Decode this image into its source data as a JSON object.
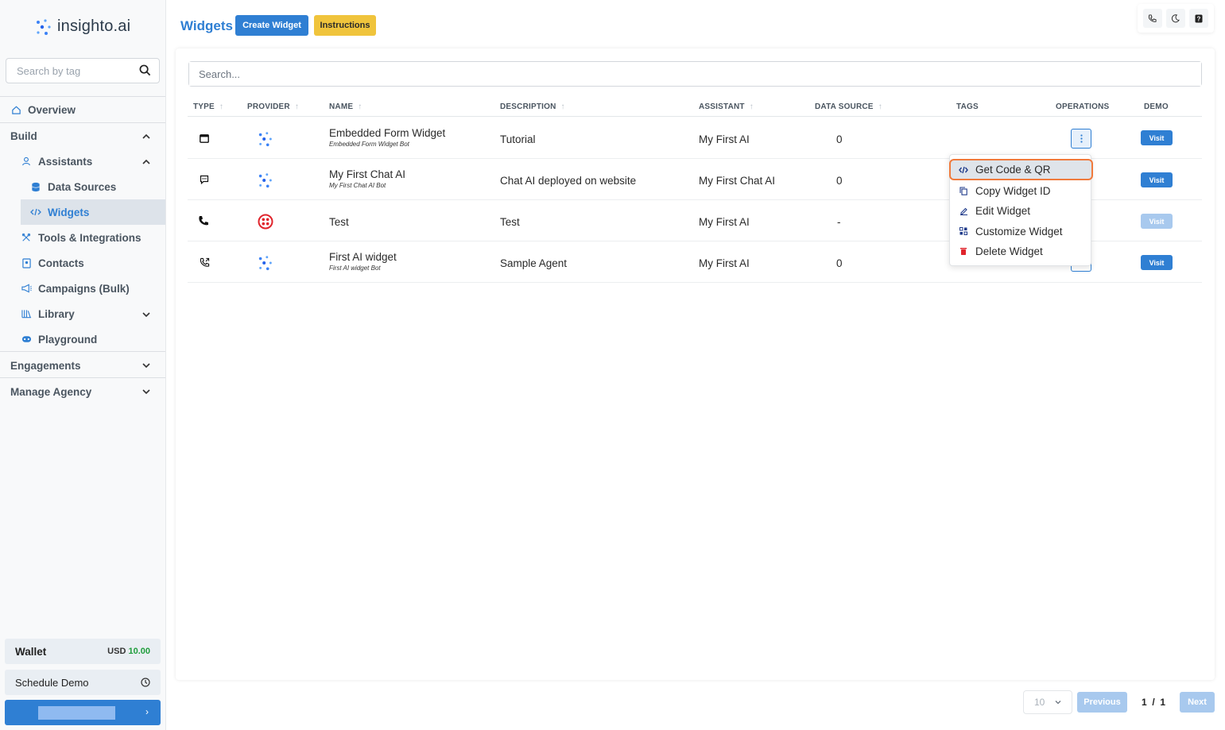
{
  "brand": {
    "name": "insighto.ai"
  },
  "sidebar": {
    "search_placeholder": "Search by tag",
    "overview": "Overview",
    "build": "Build",
    "assistants": "Assistants",
    "data_sources": "Data Sources",
    "widgets": "Widgets",
    "tools": "Tools & Integrations",
    "contacts": "Contacts",
    "campaigns": "Campaigns (Bulk)",
    "library": "Library",
    "playground": "Playground",
    "engagements": "Engagements",
    "manage_agency": "Manage Agency",
    "wallet_label": "Wallet",
    "wallet_currency": "USD",
    "wallet_amount": "10.00",
    "schedule_demo": "Schedule Demo"
  },
  "header": {
    "title": "Widgets",
    "create_button": "Create Widget",
    "instructions_button": "Instructions"
  },
  "table": {
    "search_placeholder": "Search...",
    "columns": {
      "type": "TYPE",
      "provider": "PROVIDER",
      "name": "NAME",
      "description": "DESCRIPTION",
      "assistant": "ASSISTANT",
      "data_source": "DATA SOURCE",
      "tags": "TAGS",
      "operations": "OPERATIONS",
      "demo": "DEMO"
    },
    "rows": [
      {
        "type_icon": "form-window-icon",
        "provider_icon": "insighto-logo-icon",
        "name": "Embedded Form Widget",
        "subname": "Embedded Form Widget Bot",
        "description": "Tutorial",
        "assistant": "My First AI",
        "data_source": "0",
        "demo": "Visit"
      },
      {
        "type_icon": "chat-bubble-icon",
        "provider_icon": "insighto-logo-icon",
        "name": "My First Chat AI",
        "subname": "My First Chat AI Bot",
        "description": "Chat AI deployed on website",
        "assistant": "My First Chat AI",
        "data_source": "0",
        "demo": "Visit"
      },
      {
        "type_icon": "phone-icon",
        "provider_icon": "twilio-logo-icon",
        "name": "Test",
        "subname": "",
        "description": "Test",
        "assistant": "My First AI",
        "data_source": "-",
        "demo": "Visit"
      },
      {
        "type_icon": "phone-call-icon",
        "provider_icon": "insighto-logo-icon",
        "name": "First AI widget",
        "subname": "First AI widget Bot",
        "description": "Sample Agent",
        "assistant": "My First AI",
        "data_source": "0",
        "demo": "Visit"
      }
    ]
  },
  "menu": {
    "get_code": "Get Code & QR",
    "copy_id": "Copy Widget ID",
    "edit": "Edit Widget",
    "customize": "Customize Widget",
    "delete": "Delete Widget"
  },
  "pagination": {
    "page_size": "10",
    "previous": "Previous",
    "page_info": "1  /  1",
    "next": "Next"
  },
  "colors": {
    "primary": "#2f7fd3",
    "accent_yellow": "#f0c43c",
    "highlight_orange": "#f07a3c",
    "delete_red": "#e0242c",
    "wallet_green": "#1f9d3c"
  }
}
